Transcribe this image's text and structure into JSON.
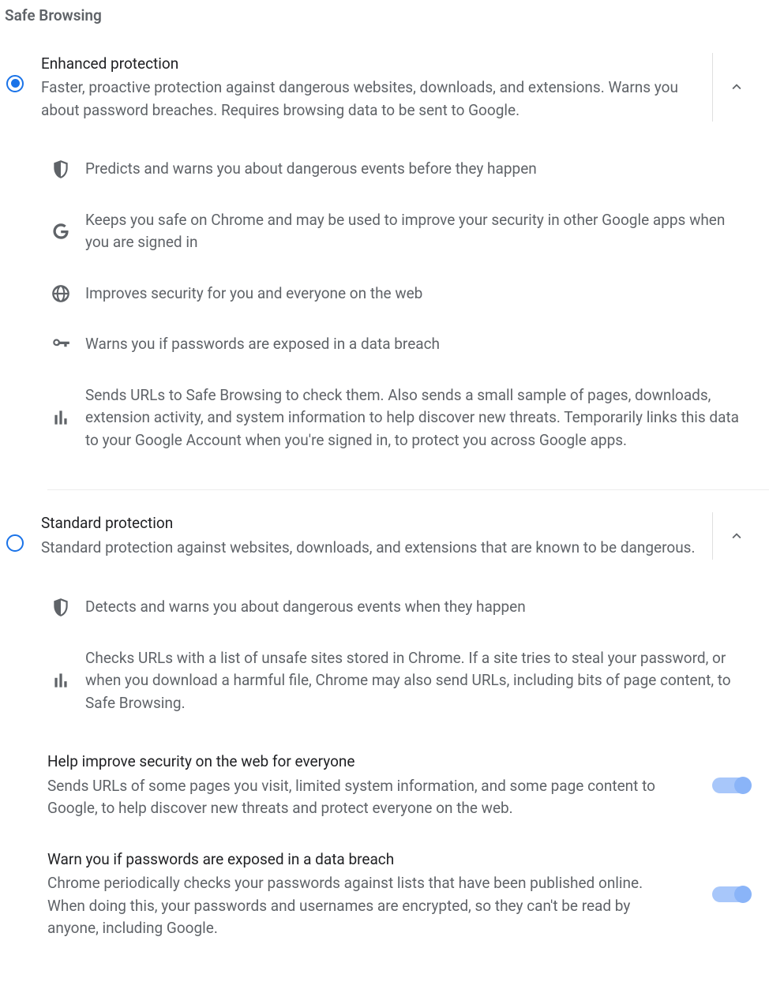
{
  "section_title": "Safe Browsing",
  "options": [
    {
      "id": "enhanced",
      "title": "Enhanced protection",
      "desc": "Faster, proactive protection against dangerous websites, downloads, and extensions. Warns you about password breaches. Requires browsing data to be sent to Google.",
      "selected": true,
      "expanded": true,
      "features": [
        {
          "icon": "shield-icon",
          "text": "Predicts and warns you about dangerous events before they happen"
        },
        {
          "icon": "google-g-icon",
          "text": "Keeps you safe on Chrome and may be used to improve your security in other Google apps when you are signed in"
        },
        {
          "icon": "globe-icon",
          "text": "Improves security for you and everyone on the web"
        },
        {
          "icon": "key-icon",
          "text": "Warns you if passwords are exposed in a data breach"
        },
        {
          "icon": "bar-chart-icon",
          "text": "Sends URLs to Safe Browsing to check them. Also sends a small sample of pages, downloads, extension activity, and system information to help discover new threats. Temporarily links this data to your Google Account when you're signed in, to protect you across Google apps."
        }
      ]
    },
    {
      "id": "standard",
      "title": "Standard protection",
      "desc": "Standard protection against websites, downloads, and extensions that are known to be dangerous.",
      "selected": false,
      "expanded": true,
      "features": [
        {
          "icon": "shield-icon",
          "text": "Detects and warns you about dangerous events when they happen"
        },
        {
          "icon": "bar-chart-icon",
          "text": "Checks URLs with a list of unsafe sites stored in Chrome. If a site tries to steal your password, or when you download a harmful file, Chrome may also send URLs, including bits of page content, to Safe Browsing."
        }
      ]
    }
  ],
  "toggles": [
    {
      "title": "Help improve security on the web for everyone",
      "desc": "Sends URLs of some pages you visit, limited system information, and some page content to Google, to help discover new threats and protect everyone on the web.",
      "on": true
    },
    {
      "title": "Warn you if passwords are exposed in a data breach",
      "desc": "Chrome periodically checks your passwords against lists that have been published online. When doing this, your passwords and usernames are encrypted, so they can't be read by anyone, including Google.",
      "on": true
    }
  ]
}
